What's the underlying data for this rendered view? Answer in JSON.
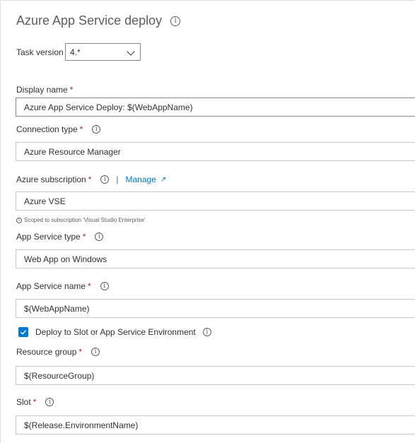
{
  "title": "Azure App Service deploy",
  "task_version": {
    "label": "Task version",
    "value": "4.*"
  },
  "display_name": {
    "label": "Display name",
    "value": "Azure App Service Deploy: $(WebAppName)"
  },
  "connection_type": {
    "label": "Connection type",
    "value": "Azure Resource Manager"
  },
  "azure_subscription": {
    "label": "Azure subscription",
    "separator": "|",
    "manage_label": "Manage",
    "value": "Azure VSE",
    "hint": "Scoped to subscription 'Visual Studio Enterprise'"
  },
  "app_service_type": {
    "label": "App Service type",
    "value": "Web App on Windows"
  },
  "app_service_name": {
    "label": "App Service name",
    "value": "$(WebAppName)"
  },
  "deploy_to_slot": {
    "label": "Deploy to Slot or App Service Environment",
    "checked": true
  },
  "resource_group": {
    "label": "Resource group",
    "value": "$(ResourceGroup)"
  },
  "slot": {
    "label": "Slot",
    "value": "$(Release.EnvironmentName)"
  },
  "required_marker": "*",
  "icons": {
    "info": "info-icon",
    "chevron": "chevron-down-icon",
    "external": "external-link-icon",
    "check": "checkmark-icon"
  },
  "colors": {
    "accent": "#0078d4",
    "required": "#a4262c",
    "text": "#323130",
    "muted": "#605e5c"
  }
}
